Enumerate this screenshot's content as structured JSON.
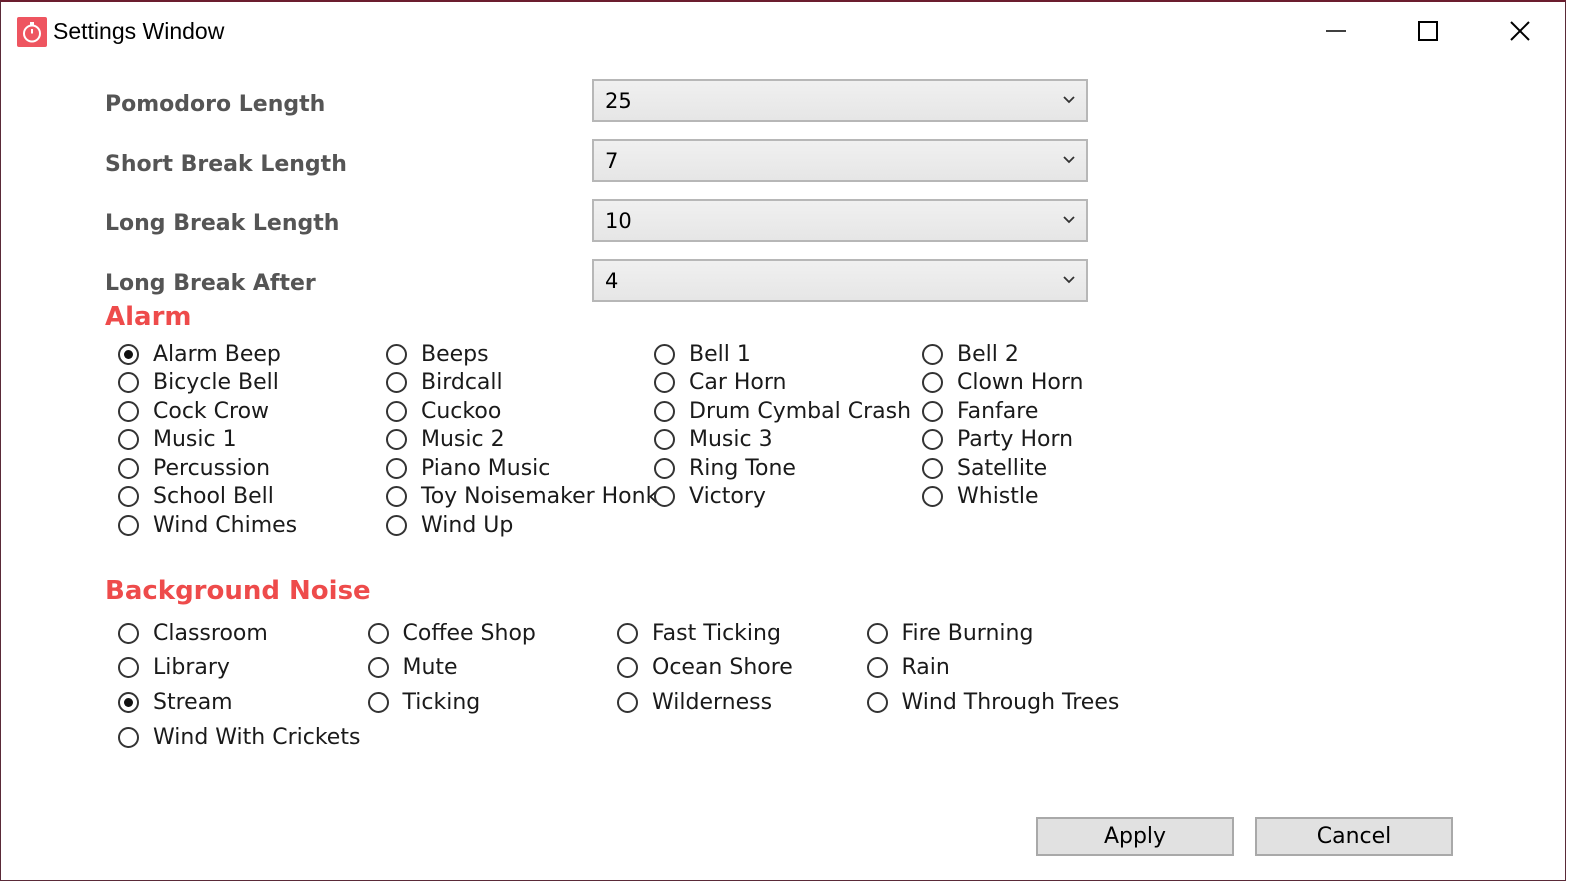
{
  "window": {
    "title": "Settings Window",
    "icon": "stopwatch-icon",
    "accent_color": "#ee5560"
  },
  "fields": [
    {
      "label": "Pomodoro Length",
      "value": "25"
    },
    {
      "label": "Short Break Length",
      "value": "7"
    },
    {
      "label": "Long Break Length",
      "value": "10"
    },
    {
      "label": "Long Break After",
      "value": "4"
    }
  ],
  "alarm": {
    "heading": "Alarm",
    "heading_color": "#ee4b4b",
    "selected": "Alarm Beep",
    "options": [
      "Alarm Beep",
      "Beeps",
      "Bell 1",
      "Bell 2",
      "Bicycle Bell",
      "Birdcall",
      "Car Horn",
      "Clown Horn",
      "Cock Crow",
      "Cuckoo",
      "Drum Cymbal Crash",
      "Fanfare",
      "Music 1",
      "Music 2",
      "Music 3",
      "Party Horn",
      "Percussion",
      "Piano Music",
      "Ring Tone",
      "Satellite",
      "School Bell",
      "Toy Noisemaker Honk",
      "Victory",
      "Whistle",
      "Wind Chimes",
      "Wind Up"
    ]
  },
  "noise": {
    "heading": "Background Noise",
    "selected": "Stream",
    "options": [
      "Classroom",
      "Coffee Shop",
      "Fast Ticking",
      "Fire Burning",
      "Library",
      "Mute",
      "Ocean Shore",
      "Rain",
      "Stream",
      "Ticking",
      "Wilderness",
      "Wind Through Trees",
      "Wind With Crickets"
    ]
  },
  "buttons": {
    "apply": "Apply",
    "cancel": "Cancel"
  }
}
